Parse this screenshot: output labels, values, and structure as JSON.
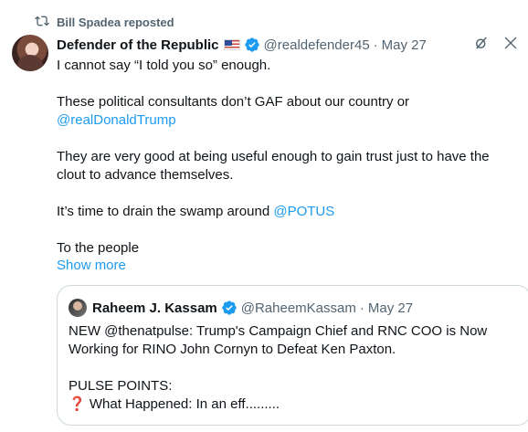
{
  "repost": {
    "label": "Bill Spadea reposted",
    "icon": "repost-icon"
  },
  "tweet": {
    "author_name": "Defender of the Republic",
    "author_flag": "🇺🇸",
    "handle": "@realdefender45",
    "separator": "·",
    "date": "May 27",
    "paragraphs": {
      "p1": "I cannot say “I told you so” enough.",
      "p2a": "These political consultants don’t GAF about our country or",
      "p2b": "@realDonaldTrump",
      "p3": "They are very good at being useful enough to gain trust just to have the clout to advance themselves.",
      "p4a": "It’s time to drain the swamp around ",
      "p4b": "@POTUS",
      "p5": "To the people"
    },
    "show_more": "Show more"
  },
  "quote": {
    "author_name": "Raheem J. Kassam",
    "handle": "@RaheemKassam",
    "separator": "·",
    "date": "May 27",
    "text1": "NEW @thenatpulse: Trump's Campaign Chief and RNC COO is Now Working for RINO John Cornyn to Defeat Ken Paxton.",
    "text2a": "PULSE POINTS:",
    "text2b_mark": "❓",
    "text2b": "What Happened: In an eff........."
  },
  "colors": {
    "accent": "#1d9bf0",
    "muted": "#536471",
    "text": "#0f1419"
  }
}
